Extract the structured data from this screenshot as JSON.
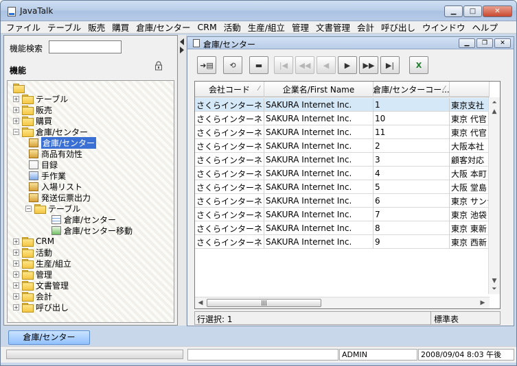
{
  "app": {
    "title": "JavaTalk"
  },
  "menu": [
    "ファイル",
    "テーブル",
    "販売",
    "購買",
    "倉庫/センター",
    "CRM",
    "活動",
    "生産/組立",
    "管理",
    "文書管理",
    "会計",
    "呼び出し",
    "ウインドウ",
    "ヘルプ"
  ],
  "left_panel": {
    "search_label": "機能検索",
    "search_value": "",
    "function_label": "機能"
  },
  "tree": [
    {
      "label": "テーブル"
    },
    {
      "label": "販売"
    },
    {
      "label": "購買"
    },
    {
      "label": "倉庫/センター"
    },
    {
      "label": "倉庫/センター"
    },
    {
      "label": "商品有効性"
    },
    {
      "label": "目録"
    },
    {
      "label": "手作業"
    },
    {
      "label": "入場リスト"
    },
    {
      "label": "発送伝票出力"
    },
    {
      "label": "テーブル"
    },
    {
      "label": "倉庫/センター"
    },
    {
      "label": "倉庫/センター移動"
    },
    {
      "label": "CRM"
    },
    {
      "label": "活動"
    },
    {
      "label": "生産/組立"
    },
    {
      "label": "管理"
    },
    {
      "label": "文書管理"
    },
    {
      "label": "会計"
    },
    {
      "label": "呼び出し"
    }
  ],
  "inner_window": {
    "title": "倉庫/センター"
  },
  "grid": {
    "headers": [
      "会社コード",
      "企業名/First Name",
      "倉庫/センターコー...",
      ""
    ],
    "rows": [
      [
        "さくらインターネット",
        "SAKURA Internet Inc.",
        "1",
        "東京支社"
      ],
      [
        "さくらインターネット",
        "SAKURA Internet Inc.",
        "10",
        "東京 代官"
      ],
      [
        "さくらインターネット",
        "SAKURA Internet Inc.",
        "11",
        "東京 代官"
      ],
      [
        "さくらインターネット",
        "SAKURA Internet Inc.",
        "2",
        "大阪本社"
      ],
      [
        "さくらインターネット",
        "SAKURA Internet Inc.",
        "3",
        "顧客対応"
      ],
      [
        "さくらインターネット",
        "SAKURA Internet Inc.",
        "4",
        "大阪 本町"
      ],
      [
        "さくらインターネット",
        "SAKURA Internet Inc.",
        "5",
        "大阪 堂島"
      ],
      [
        "さくらインターネット",
        "SAKURA Internet Inc.",
        "6",
        "東京 サンシ"
      ],
      [
        "さくらインターネット",
        "SAKURA Internet Inc.",
        "7",
        "東京 池袋"
      ],
      [
        "さくらインターネット",
        "SAKURA Internet Inc.",
        "8",
        "東京 東新"
      ],
      [
        "さくらインターネット",
        "SAKURA Internet Inc.",
        "9",
        "東京 西新"
      ]
    ],
    "status_left": "行選択: 1",
    "status_right": "標準表"
  },
  "taskbar": {
    "tab_label": "倉庫/センター"
  },
  "statusbar": {
    "user": "ADMIN",
    "datetime": "2008/09/04 8:03 午後"
  }
}
